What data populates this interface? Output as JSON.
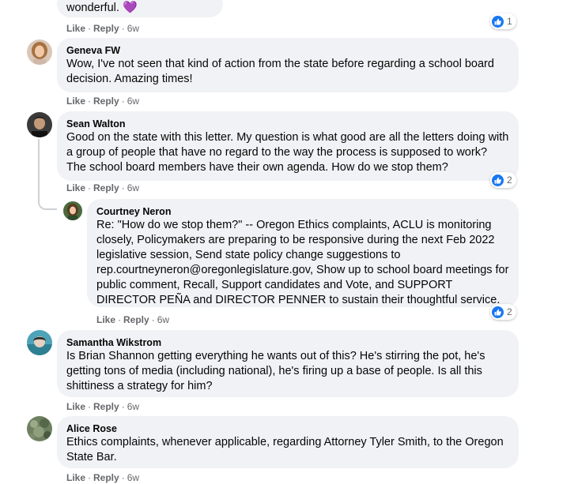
{
  "comments": [
    {
      "text_tail": "wonderful.",
      "emoji": "💜",
      "actions": {
        "like": "Like",
        "reply": "Reply",
        "time": "6w"
      },
      "reactions": {
        "count": "1"
      }
    },
    {
      "author": "Geneva FW",
      "text": "Wow, I've not seen that kind of action from the state before regarding a school board decision. Amazing times!",
      "actions": {
        "like": "Like",
        "reply": "Reply",
        "time": "6w"
      }
    },
    {
      "author": "Sean Walton",
      "text": "Good on the state with this letter. My question is what good are all the letters doing with a group of people that have no regard to the way the process is supposed to work? The school board members have their own agenda. How do we stop them?",
      "actions": {
        "like": "Like",
        "reply": "Reply",
        "time": "6w"
      },
      "reactions": {
        "count": "2"
      }
    },
    {
      "author": "Courtney Neron",
      "text": "Re: \"How do we stop them?\" -- Oregon Ethics complaints, ACLU is monitoring closely, Policymakers are preparing to be responsive during the next Feb 2022 legislative session, Send state policy change suggestions to rep.courtneyneron@oregonlegislature.gov, Show up to school board meetings for public comment, Recall, Support candidates and Vote, and SUPPORT DIRECTOR PEÑA and DIRECTOR PENNER to sustain their thoughtful service.",
      "actions": {
        "like": "Like",
        "reply": "Reply",
        "time": "6w"
      },
      "reactions": {
        "count": "2"
      }
    },
    {
      "author": "Samantha Wikstrom",
      "text": "Is Brian Shannon getting everything he wants out of this? He's stirring the pot, he's getting tons of media (including national), he's firing up a base of people. Is all this shittiness a strategy for him?",
      "actions": {
        "like": "Like",
        "reply": "Reply",
        "time": "6w"
      }
    },
    {
      "author": "Alice Rose",
      "text": "Ethics complaints, whenever applicable, regarding Attorney Tyler Smith, to the Oregon State Bar.",
      "actions": {
        "like": "Like",
        "reply": "Reply",
        "time": "6w"
      }
    }
  ],
  "colors": {
    "bubble": "#f0f2f5",
    "meta": "#65676b",
    "like_blue": "#1877f2"
  }
}
